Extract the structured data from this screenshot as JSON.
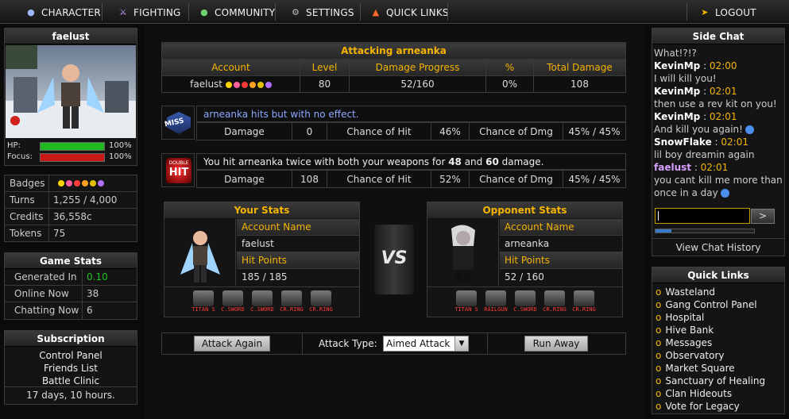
{
  "nav": {
    "character": "CHARACTER",
    "fighting": "FIGHTING",
    "community": "COMMUNITY",
    "settings": "SETTINGS",
    "quick_links": "QUICK LINKS",
    "logout": "LOGOUT"
  },
  "profile": {
    "name": "faelust",
    "hp_label": "HP:",
    "hp_pct": "100%",
    "hp_fill": 1.0,
    "focus_label": "Focus:",
    "focus_pct": "100%",
    "focus_fill": 1.0
  },
  "account_info": [
    {
      "label": "Badges",
      "value": ""
    },
    {
      "label": "Turns",
      "value": "1,255 / 4,000"
    },
    {
      "label": "Credits",
      "value": "36,558c"
    },
    {
      "label": "Tokens",
      "value": "75"
    }
  ],
  "game_stats": {
    "title": "Game Stats",
    "rows": [
      {
        "label": "Generated In",
        "value": "0.10"
      },
      {
        "label": "Online Now",
        "value": "38"
      },
      {
        "label": "Chatting Now",
        "value": "6"
      }
    ]
  },
  "subscription": {
    "title": "Subscription",
    "links": [
      "Control Panel",
      "Friends List",
      "Battle Clinic"
    ],
    "remaining": "17 days, 10 hours."
  },
  "attack": {
    "title": "Attacking arneanka",
    "headers": [
      "Account",
      "Level",
      "Damage Progress",
      "%",
      "Total Damage"
    ],
    "row": {
      "account": "faelust",
      "level": "80",
      "progress": "52/160",
      "pct": "0%",
      "total": "108"
    }
  },
  "log1": {
    "badge": "MISS",
    "message": "arneanka hits but with no effect.",
    "damage_label": "Damage",
    "damage": "0",
    "hit_label": "Chance of Hit",
    "hit": "46%",
    "dmg_label": "Chance of Dmg",
    "dmg": "45% / 45%"
  },
  "log2": {
    "badge_top": "DOUBLE",
    "badge_bottom": "HIT",
    "msg_pre": "You hit arneanka twice with both your weapons for ",
    "msg_a": "48",
    "msg_mid": " and ",
    "msg_b": "60",
    "msg_post": " damage.",
    "damage_label": "Damage",
    "damage": "108",
    "hit_label": "Chance of Hit",
    "hit": "52%",
    "dmg_label": "Chance of Dmg",
    "dmg": "45% / 45%"
  },
  "your_stats": {
    "title": "Your Stats",
    "name_label": "Account Name",
    "name": "faelust",
    "hp_label": "Hit Points",
    "hp": "185 / 185",
    "equipment": [
      "TITAN S",
      "C.SWORD",
      "C.SWORD",
      "CR.RING",
      "CR.RING"
    ]
  },
  "opp_stats": {
    "title": "Opponent Stats",
    "name_label": "Account Name",
    "name": "arneanka",
    "hp_label": "Hit Points",
    "hp": "52 / 160",
    "equipment": [
      "TITAN S",
      "RAILGUN",
      "C.SWORD",
      "CR.RING",
      "CR.RING"
    ]
  },
  "vs": "VS",
  "actions": {
    "attack_again": "Attack Again",
    "attack_type_label": "Attack Type:",
    "attack_type_value": "Aimed Attack",
    "run_away": "Run Away"
  },
  "side_chat": {
    "title": "Side Chat",
    "messages": [
      {
        "user": "",
        "time": "",
        "text": "What!?!?"
      },
      {
        "user": "KevinMp",
        "time": "02:00",
        "text": "I will kill you!"
      },
      {
        "user": "KevinMp",
        "time": "02:01",
        "text": "then use a rev kit on you!"
      },
      {
        "user": "KevinMp",
        "time": "02:01",
        "text": "And kill you again!"
      },
      {
        "user": "SnowFlake",
        "time": "02:01",
        "text": "lil boy dreamin again"
      },
      {
        "user": "faelust",
        "time": "02:01",
        "text": "you cant kill me more than once in a day"
      }
    ],
    "send": ">",
    "history": "View Chat History"
  },
  "quick_links": {
    "title": "Quick Links",
    "items": [
      "Wasteland",
      "Gang Control Panel",
      "Hospital",
      "Hive Bank",
      "Messages",
      "Observatory",
      "Market Square",
      "Sanctuary of Healing",
      "Clan Hideouts",
      "Vote for Legacy"
    ]
  }
}
